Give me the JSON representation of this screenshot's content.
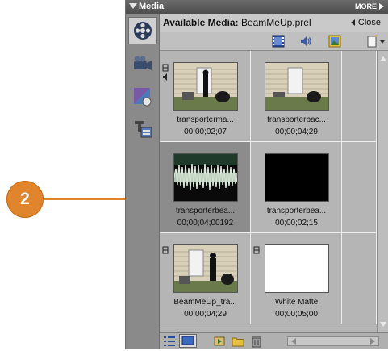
{
  "callout": {
    "number": "2"
  },
  "panel": {
    "title": "Media",
    "more_label": "MORE"
  },
  "header": {
    "label": "Available Media:",
    "value": "BeamMeUp.prel",
    "close_label": "Close"
  },
  "media_items": [
    {
      "name": "transporterma...",
      "duration": "00;00;02;07"
    },
    {
      "name": "transporterbac...",
      "duration": "00;00;04;29"
    },
    {
      "name": "transporterbea...",
      "duration": "00;00;04;00192"
    },
    {
      "name": "transporterbea...",
      "duration": "00;00;02;15"
    },
    {
      "name": "BeamMeUp_tra...",
      "duration": "00;00;04;29"
    },
    {
      "name": "White Matte",
      "duration": "00;00;05;00"
    }
  ],
  "colors": {
    "callout": "#e0852b",
    "panel_bg": "#a9a9a9",
    "selected_cell": "#8c8c8c"
  }
}
